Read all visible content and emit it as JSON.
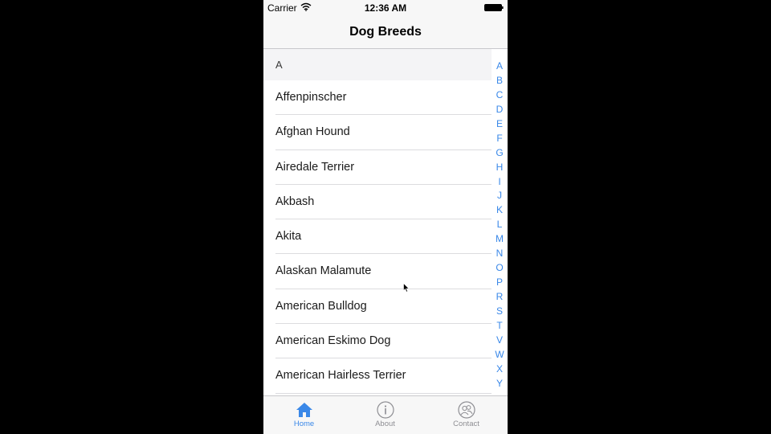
{
  "status_bar": {
    "carrier": "Carrier",
    "time": "12:36 AM",
    "icons": [
      "wifi-icon",
      "battery-icon"
    ]
  },
  "nav": {
    "title": "Dog Breeds"
  },
  "list": {
    "section": "A",
    "rows": [
      "Affenpinscher",
      "Afghan Hound",
      "Airedale Terrier",
      "Akbash",
      "Akita",
      "Alaskan Malamute",
      "American Bulldog",
      "American Eskimo Dog",
      "American Hairless Terrier"
    ]
  },
  "index": [
    "A",
    "B",
    "C",
    "D",
    "E",
    "F",
    "G",
    "H",
    "I",
    "J",
    "K",
    "L",
    "M",
    "N",
    "O",
    "P",
    "R",
    "S",
    "T",
    "V",
    "W",
    "X",
    "Y"
  ],
  "tabs": [
    {
      "label": "Home",
      "icon": "home-icon",
      "active": true
    },
    {
      "label": "About",
      "icon": "info-icon",
      "active": false
    },
    {
      "label": "Contact",
      "icon": "contacts-icon",
      "active": false
    }
  ],
  "colors": {
    "accent": "#3a88e8",
    "inactive": "#8e8e93",
    "bar_background": "#f7f7f7"
  }
}
